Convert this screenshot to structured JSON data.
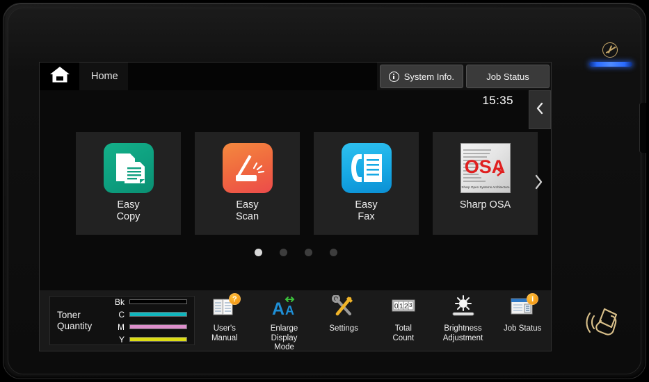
{
  "device": {
    "power_icon": "power-symbol-icon",
    "nfc_icon": "nfc-touch-hand-icon"
  },
  "topbar": {
    "home_icon": "home-icon",
    "title": "Home",
    "system_info": {
      "label": "System Info.",
      "icon": "info-circle-icon"
    },
    "job_status": {
      "label": "Job Status"
    }
  },
  "clock": {
    "time": "15:35",
    "collapse_icon": "chevron-left-icon"
  },
  "apps": {
    "next_icon": "chevron-right-icon",
    "tiles": [
      {
        "label": "Easy\nCopy",
        "icon": "easy-copy-icon",
        "color": "#0d9f7f"
      },
      {
        "label": "Easy\nScan",
        "icon": "easy-scan-icon",
        "color": "#f0693f"
      },
      {
        "label": "Easy\nFax",
        "icon": "easy-fax-icon",
        "color": "#17a9e4"
      },
      {
        "label": "Sharp OSA",
        "icon": "sharp-osa-icon",
        "color": "#e6e6e6",
        "logo_text": "OSA",
        "logo_caption": "Sharp Open Systems Architecture"
      }
    ]
  },
  "pager": {
    "count": 4,
    "active": 0
  },
  "toner": {
    "label": "Toner\nQuantity",
    "levels": [
      {
        "key": "Bk",
        "color": "#000000",
        "percent": 100
      },
      {
        "key": "C",
        "color": "#11b6bd",
        "percent": 100
      },
      {
        "key": "M",
        "color": "#dd8ecb",
        "percent": 100
      },
      {
        "key": "Y",
        "color": "#dcdc14",
        "percent": 100
      }
    ]
  },
  "tools": [
    {
      "label": "User's\nManual",
      "icon": "users-manual-icon",
      "badge": "?"
    },
    {
      "label": "Enlarge\nDisplay\nMode",
      "icon": "enlarge-display-mode-icon",
      "badge": ""
    },
    {
      "label": "Settings",
      "icon": "settings-wrench-icon",
      "badge": ""
    },
    {
      "label": "Total\nCount",
      "icon": "total-count-icon",
      "badge": ""
    },
    {
      "label": "Brightness\nAdjustment",
      "icon": "brightness-adjustment-icon",
      "badge": ""
    },
    {
      "label": "Job Status",
      "icon": "job-status-icon",
      "badge": "i"
    }
  ]
}
